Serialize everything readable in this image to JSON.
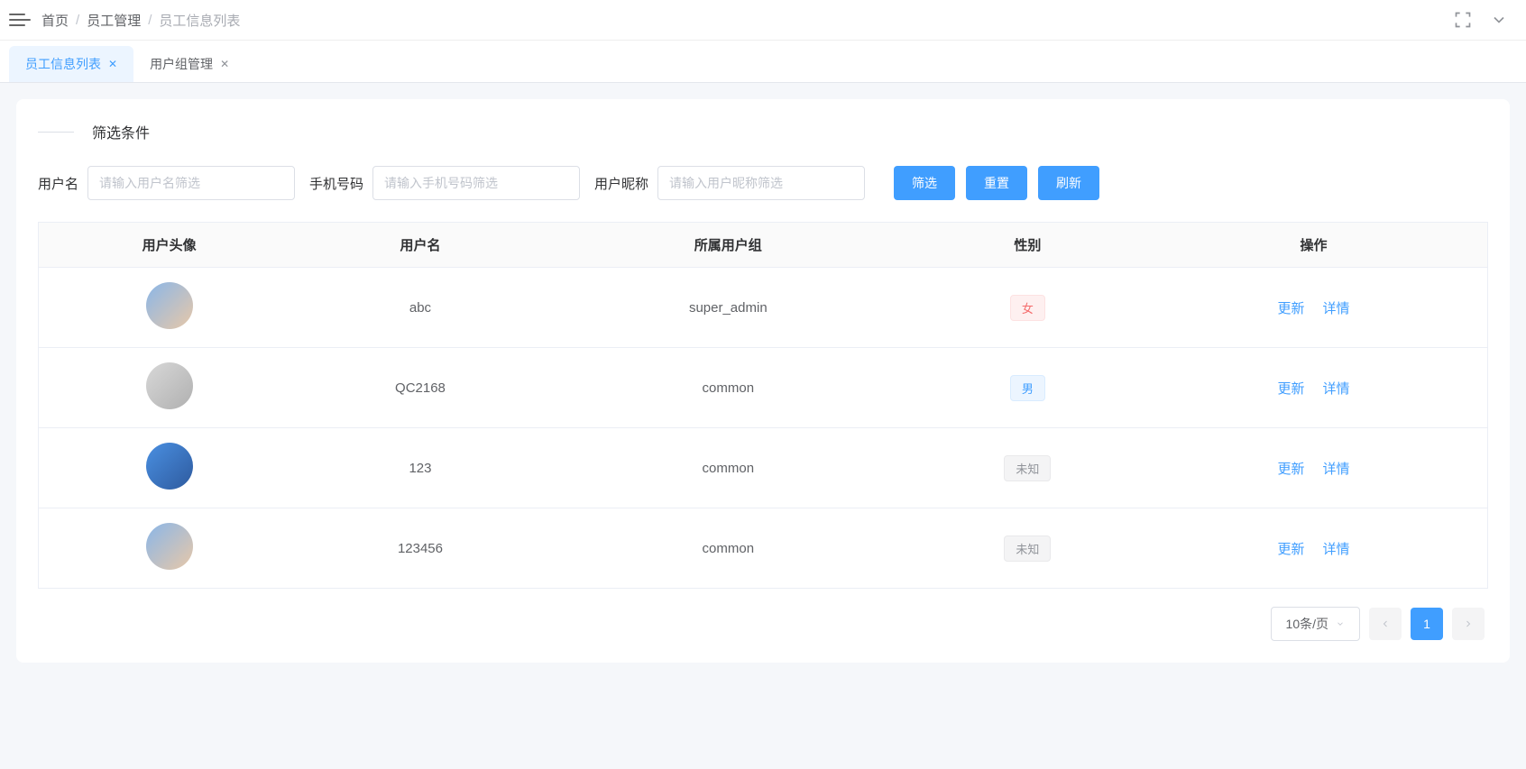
{
  "breadcrumb": {
    "home": "首页",
    "section": "员工管理",
    "current": "员工信息列表"
  },
  "tabs": [
    {
      "label": "员工信息列表",
      "active": true
    },
    {
      "label": "用户组管理",
      "active": false
    }
  ],
  "filter": {
    "section_title": "筛选条件",
    "username_label": "用户名",
    "username_placeholder": "请输入用户名筛选",
    "phone_label": "手机号码",
    "phone_placeholder": "请输入手机号码筛选",
    "nickname_label": "用户昵称",
    "nickname_placeholder": "请输入用户昵称筛选",
    "filter_btn": "筛选",
    "reset_btn": "重置",
    "refresh_btn": "刷新"
  },
  "table": {
    "headers": {
      "avatar": "用户头像",
      "username": "用户名",
      "group": "所属用户组",
      "gender": "性别",
      "actions": "操作"
    },
    "action_update": "更新",
    "action_detail": "详情",
    "rows": [
      {
        "username": "abc",
        "group": "super_admin",
        "gender": "女",
        "gender_class": "female",
        "avatar_class": "av1"
      },
      {
        "username": "QC2168",
        "group": "common",
        "gender": "男",
        "gender_class": "male",
        "avatar_class": "av2"
      },
      {
        "username": "123",
        "group": "common",
        "gender": "未知",
        "gender_class": "unknown",
        "avatar_class": "av3"
      },
      {
        "username": "123456",
        "group": "common",
        "gender": "未知",
        "gender_class": "unknown",
        "avatar_class": "av4"
      }
    ]
  },
  "pagination": {
    "page_size_label": "10条/页",
    "current_page": "1"
  }
}
